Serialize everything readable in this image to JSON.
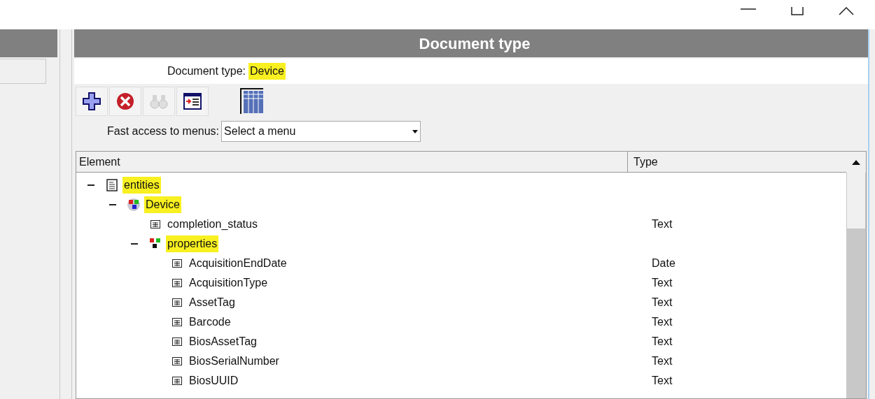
{
  "panel": {
    "title": "Document type"
  },
  "document_type": {
    "label": "Document type:",
    "value": "Device",
    "highlighted": true
  },
  "toolbar": [
    {
      "kind": "add",
      "disabled": false
    },
    {
      "kind": "delete",
      "disabled": false
    },
    {
      "kind": "find",
      "disabled": true
    },
    {
      "kind": "form",
      "disabled": false
    },
    {
      "kind": "grid",
      "disabled": false
    }
  ],
  "fast_access": {
    "label": "Fast access to menus:",
    "value": "Select a menu"
  },
  "table": {
    "columns": [
      "Element",
      "Type"
    ],
    "tree": [
      {
        "name": "entities",
        "kind": "document",
        "highlighted": true,
        "expanded": true,
        "children": [
          {
            "name": "Device",
            "kind": "entity",
            "highlighted": true,
            "expanded": true,
            "children": [
              {
                "name": "completion_status",
                "kind": "field",
                "highlighted": false,
                "type": "Text"
              },
              {
                "name": "properties",
                "kind": "group",
                "highlighted": true,
                "expanded": true,
                "children": [
                  {
                    "name": "AcquisitionEndDate",
                    "kind": "field",
                    "highlighted": false,
                    "type": "Date"
                  },
                  {
                    "name": "AcquisitionType",
                    "kind": "field",
                    "highlighted": false,
                    "type": "Text"
                  },
                  {
                    "name": "AssetTag",
                    "kind": "field",
                    "highlighted": false,
                    "type": "Text"
                  },
                  {
                    "name": "Barcode",
                    "kind": "field",
                    "highlighted": false,
                    "type": "Text"
                  },
                  {
                    "name": "BiosAssetTag",
                    "kind": "field",
                    "highlighted": false,
                    "type": "Text"
                  },
                  {
                    "name": "BiosSerialNumber",
                    "kind": "field",
                    "highlighted": false,
                    "type": "Text"
                  },
                  {
                    "name": "BiosUUID",
                    "kind": "field",
                    "highlighted": false,
                    "type": "Text"
                  }
                ]
              }
            ]
          }
        ]
      }
    ]
  }
}
